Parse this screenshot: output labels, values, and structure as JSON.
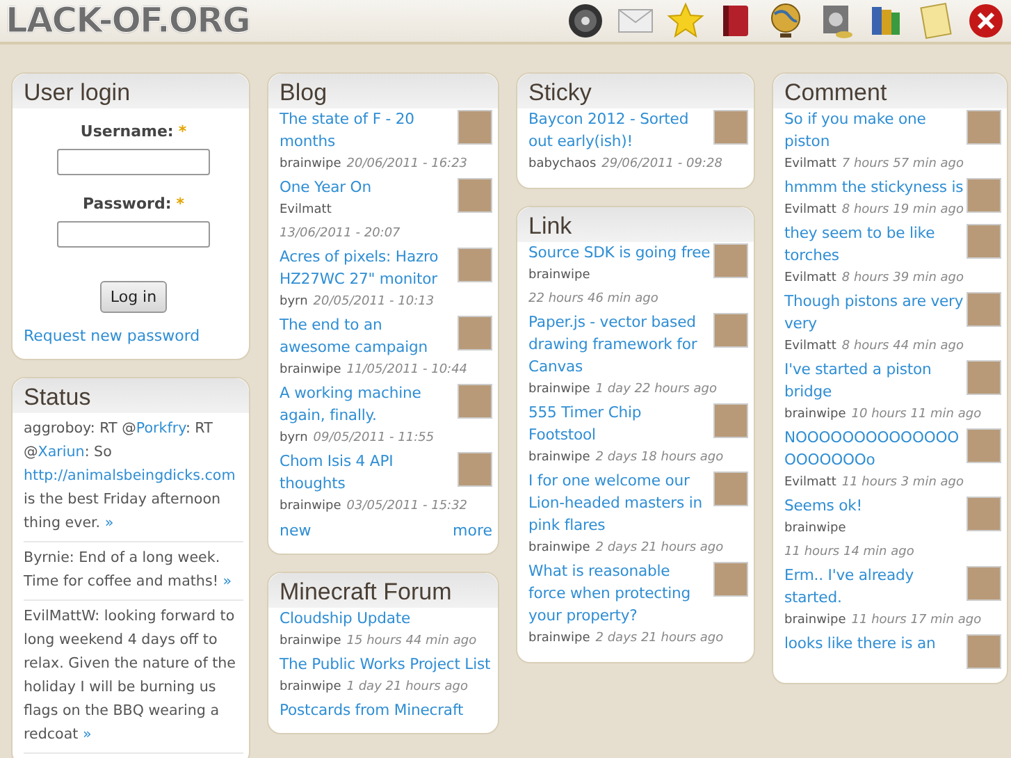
{
  "header": {
    "logo": "LACK-OF.ORG"
  },
  "login": {
    "title": "User login",
    "fields": [
      {
        "label": "Username:",
        "required_mark": "*"
      },
      {
        "label": "Password:",
        "required_mark": "*"
      }
    ],
    "button": "Log in",
    "link": "Request new password"
  },
  "status": {
    "title": "Status",
    "items": [
      {
        "parts": [
          {
            "text": "aggroboy: RT @"
          },
          {
            "text": "Porkfry",
            "link": true
          },
          {
            "text": ": RT @"
          },
          {
            "text": "Xariun",
            "link": true
          },
          {
            "text": ": So "
          },
          {
            "text": "http://animalsbeingdicks.com",
            "link": true
          },
          {
            "text": " is the best Friday afternoon thing ever. "
          },
          {
            "text": "»",
            "link": true
          }
        ]
      },
      {
        "parts": [
          {
            "text": "Byrnie: End of a long week. Time for coffee and maths! "
          },
          {
            "text": "»",
            "link": true
          }
        ]
      },
      {
        "parts": [
          {
            "text": "EvilMattW: looking forward to long weekend 4 days off to relax. Given the nature of the holiday I will be burning us flags on the BBQ wearing a redcoat "
          },
          {
            "text": "»",
            "link": true
          }
        ]
      }
    ]
  },
  "blog": {
    "title": "Blog",
    "items": [
      {
        "title": "The state of F - 20 months",
        "author": "brainwipe",
        "date": "20/06/2011 - 16:23"
      },
      {
        "title": "One Year On",
        "author": "Evilmatt",
        "date": "13/06/2011 - 20:07"
      },
      {
        "title": "Acres of pixels: Hazro HZ27WC 27\" monitor",
        "author": "byrn",
        "date": "20/05/2011 - 10:13"
      },
      {
        "title": "The end to an awesome campaign",
        "author": "brainwipe",
        "date": "11/05/2011 - 10:44"
      },
      {
        "title": "A working machine again, finally.",
        "author": "byrn",
        "date": "09/05/2011 - 11:55"
      },
      {
        "title": "Chom Isis 4 API thoughts",
        "author": "brainwipe",
        "date": "03/05/2011 - 15:32"
      }
    ],
    "links": [
      "new",
      "more"
    ]
  },
  "minecraft_forum": {
    "title": "Minecraft Forum",
    "items": [
      {
        "title": "Cloudship Update",
        "author": "brainwipe",
        "date": "15 hours 44 min ago",
        "avatar": false
      },
      {
        "title": "The Public Works Project List",
        "author": "brainwipe",
        "date": "1 day 21 hours ago",
        "avatar": false
      },
      {
        "title": "Postcards from Minecraft",
        "avatar": false
      }
    ]
  },
  "sticky": {
    "title": "Sticky",
    "items": [
      {
        "title": "Baycon 2012 - Sorted out early(ish)!",
        "author": "babychaos",
        "date": "29/06/2011 - 09:28"
      }
    ]
  },
  "link": {
    "title": "Link",
    "items": [
      {
        "title": "Source SDK is going free",
        "author": "brainwipe",
        "date": "22 hours 46 min ago"
      },
      {
        "title": "Paper.js - vector based drawing framework for Canvas",
        "author": "brainwipe",
        "date": "1 day 22 hours ago"
      },
      {
        "title": "555 Timer Chip Footstool",
        "author": "brainwipe",
        "date": "2 days 18 hours ago"
      },
      {
        "title": "I for one welcome our Lion-headed masters in pink flares",
        "author": "brainwipe",
        "date": "2 days 21 hours ago"
      },
      {
        "title": "What is reasonable force when protecting your property?",
        "author": "brainwipe",
        "date": "2 days 21 hours ago"
      }
    ]
  },
  "comment": {
    "title": "Comment",
    "items": [
      {
        "title": "So if you make one piston",
        "author": "Evilmatt",
        "date": "7 hours 57 min ago"
      },
      {
        "title": "hmmm the stickyness is",
        "author": "Evilmatt",
        "date": "8 hours 19 min ago"
      },
      {
        "title": "they seem to be like torches",
        "author": "Evilmatt",
        "date": "8 hours 39 min ago"
      },
      {
        "title": "Though pistons are very very",
        "author": "Evilmatt",
        "date": "8 hours 44 min ago"
      },
      {
        "title": "I've started a piston bridge",
        "author": "brainwipe",
        "date": "10 hours 11 min ago"
      },
      {
        "title": "NOOOOOOOOOOOOOOOOOOOOOo",
        "author": "Evilmatt",
        "date": "11 hours 3 min ago"
      },
      {
        "title": "Seems ok!",
        "author": "brainwipe",
        "date": "11 hours 14 min ago"
      },
      {
        "title": "Erm.. I've already started.",
        "author": "brainwipe",
        "date": "11 hours 17 min ago"
      },
      {
        "title": "looks like there is an"
      }
    ]
  }
}
